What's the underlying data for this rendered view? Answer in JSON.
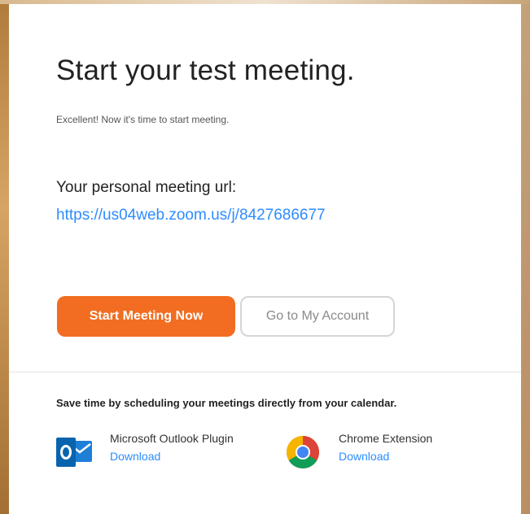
{
  "main": {
    "title": "Start your test meeting.",
    "subtitle": "Excellent! Now it's time to start meeting.",
    "url_label": "Your personal meeting url:",
    "url": "https://us04web.zoom.us/j/8427686677"
  },
  "buttons": {
    "start_label": "Start Meeting Now",
    "account_label": "Go to My Account"
  },
  "calendar": {
    "text": "Save time by scheduling your meetings directly from your calendar.",
    "plugins": [
      {
        "name": "Microsoft Outlook Plugin",
        "action": "Download",
        "icon": "outlook-icon"
      },
      {
        "name": "Chrome Extension",
        "action": "Download",
        "icon": "chrome-icon"
      }
    ]
  },
  "colors": {
    "accent": "#f26d21",
    "link": "#2d8cff",
    "outlook_blue": "#0a64ad"
  }
}
